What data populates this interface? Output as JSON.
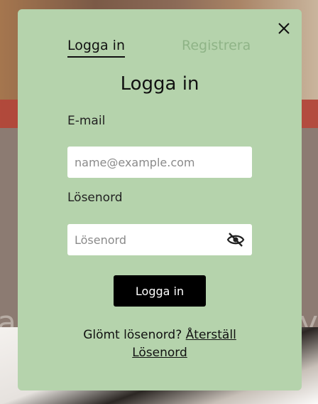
{
  "background": {
    "blurred_text_left": "al",
    "blurred_text_right": "y"
  },
  "modal": {
    "tabs": [
      {
        "label": "Logga in",
        "active": true
      },
      {
        "label": "Registrera",
        "active": false
      }
    ],
    "title": "Logga in",
    "email": {
      "label": "E-mail",
      "placeholder": "name@example.com",
      "value": ""
    },
    "password": {
      "label": "Lösenord",
      "placeholder": "Lösenord",
      "value": "",
      "toggle_icon": "eye-slash-icon"
    },
    "submit_label": "Logga in",
    "forgot": {
      "text": "Glömt lösenord? ",
      "link_line1": "Återställ",
      "link_line2": "Lösenord"
    },
    "close_icon": "close-icon"
  },
  "colors": {
    "modal_bg": "#b5d3ac",
    "inactive_tab": "#8fb487",
    "button_bg": "#000000",
    "button_text": "#ffffff"
  }
}
